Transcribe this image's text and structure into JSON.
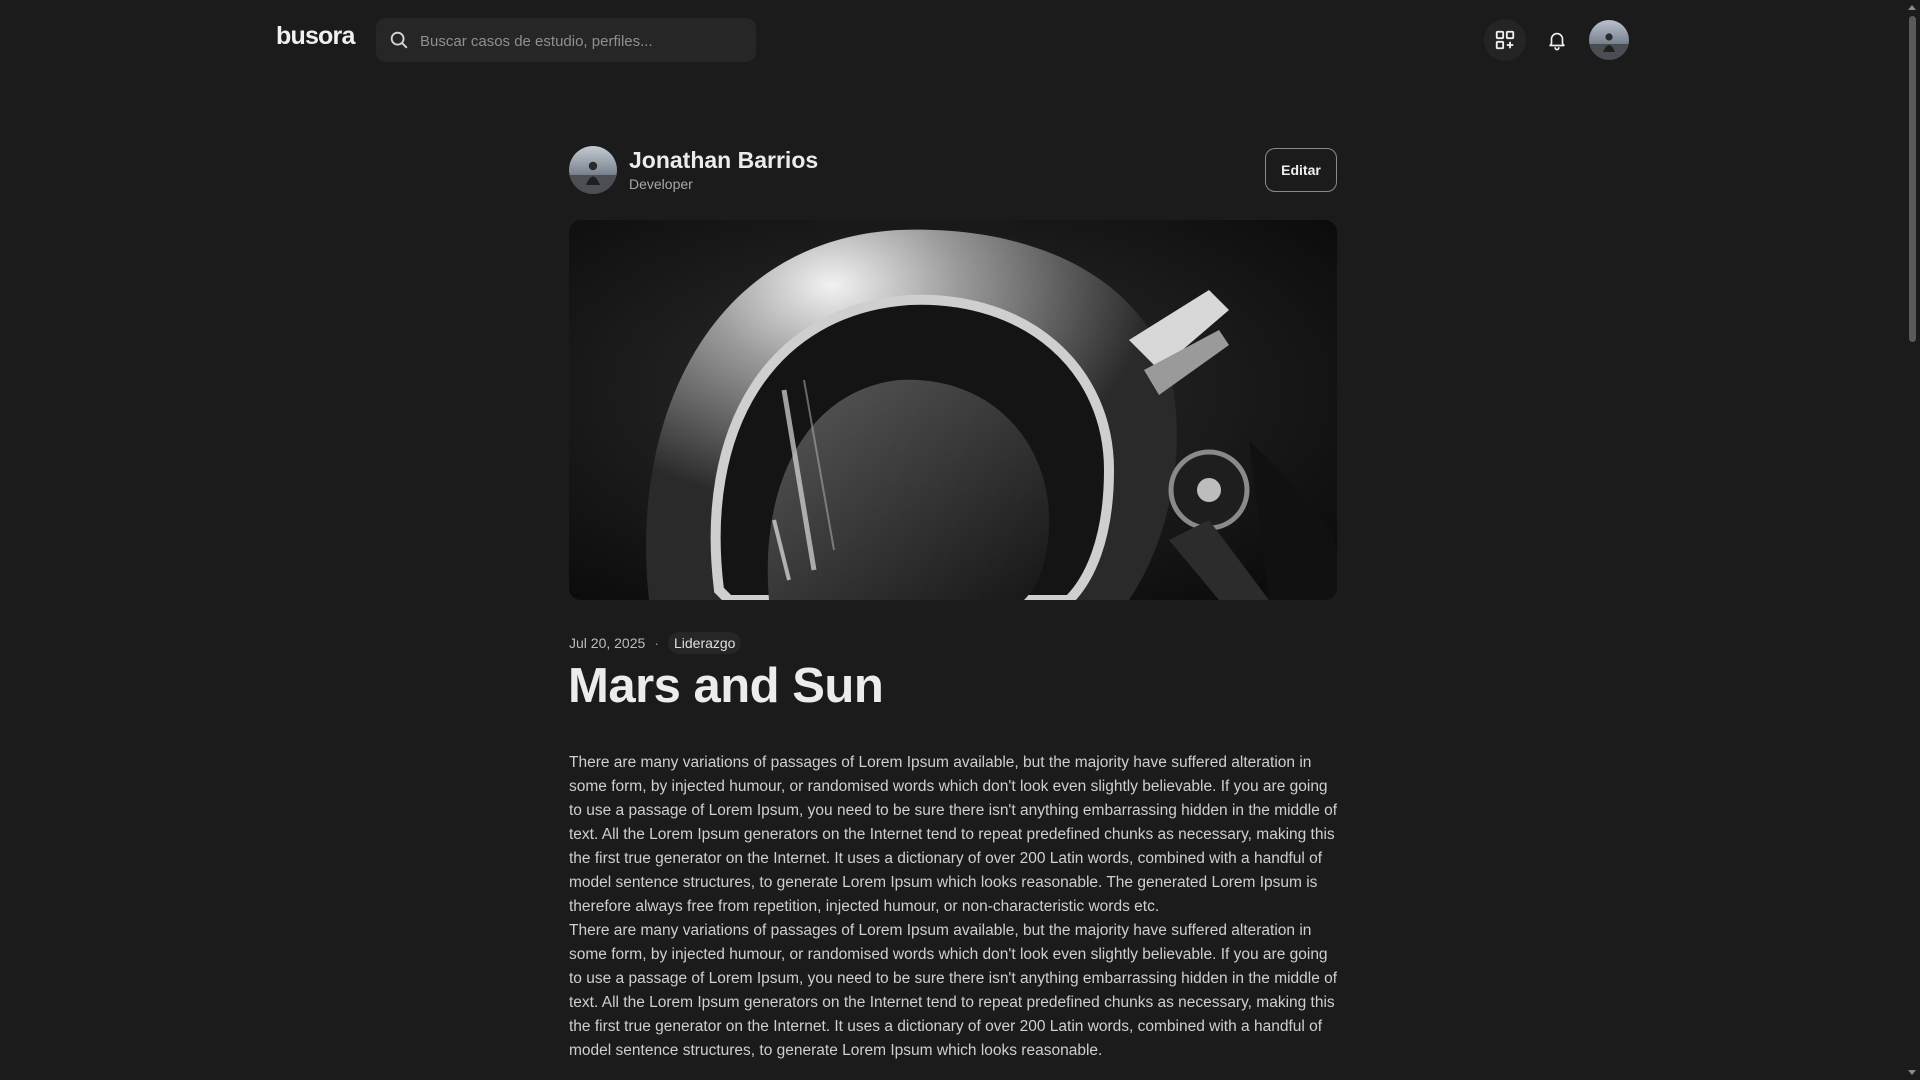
{
  "header": {
    "logo": "busora",
    "search_placeholder": "Buscar casos de estudio, perfiles...",
    "icons": [
      "search-icon",
      "apps-add-icon",
      "bell-icon",
      "avatar"
    ]
  },
  "author": {
    "name": "Jonathan Barrios",
    "role": "Developer",
    "edit_label": "Editar"
  },
  "article": {
    "date": "Jul 20, 2025",
    "separator": "·",
    "tag": "Liderazgo",
    "title": "Mars and Sun",
    "paragraphs": [
      "There are many variations of passages of Lorem Ipsum available, but the majority have suffered alteration in some form, by injected humour, or randomised words which don't look even slightly believable. If you are going to use a passage of Lorem Ipsum, you need to be sure there isn't anything embarrassing hidden in the middle of text. All the Lorem Ipsum generators on the Internet tend to repeat predefined chunks as necessary, making this the first true generator on the Internet. It uses a dictionary of over 200 Latin words, combined with a handful of model sentence structures, to generate Lorem Ipsum which looks reasonable. The generated Lorem Ipsum is therefore always free from repetition, injected humour, or non-characteristic words etc.",
      "There are many variations of passages of Lorem Ipsum available, but the majority have suffered alteration in some form, by injected humour, or randomised words which don't look even slightly believable. If you are going to use a passage of Lorem Ipsum, you need to be sure there isn't anything embarrassing hidden in the middle of text. All the Lorem Ipsum generators on the Internet tend to repeat predefined chunks as necessary, making this the first true generator on the Internet. It uses a dictionary of over 200 Latin words, combined with a handful of model sentence structures, to generate Lorem Ipsum which looks reasonable."
    ]
  },
  "colors": {
    "background": "#1b1b1b",
    "surface": "#262626",
    "text_primary": "#ececec",
    "text_secondary": "#a8a8a8"
  }
}
